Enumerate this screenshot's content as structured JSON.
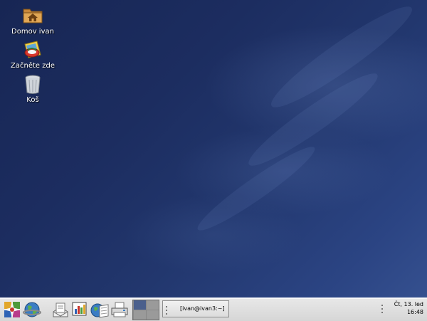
{
  "desktop": {
    "icons": [
      {
        "label": "Domov ivan",
        "icon": "home-folder-icon"
      },
      {
        "label": "Začněte zde",
        "icon": "start-here-icon"
      },
      {
        "label": "Koš",
        "icon": "trash-icon"
      }
    ]
  },
  "panel": {
    "launchers": [
      {
        "name": "main-menu-icon"
      },
      {
        "name": "web-browser-icon"
      },
      {
        "name": "email-client-icon"
      },
      {
        "name": "presentation-icon"
      },
      {
        "name": "document-editor-icon"
      },
      {
        "name": "printer-icon"
      }
    ],
    "workspaces": {
      "count": 4,
      "active": 1
    },
    "taskbar": {
      "items": [
        {
          "label": "[ivan@ivan3:~]"
        }
      ]
    },
    "clock": {
      "day": "Čt, 13. led",
      "time": "16:48"
    }
  },
  "colors": {
    "desktop_bg": "#1c2d60",
    "panel_bg": "#dcdcdc",
    "active_workspace": "#4a5f8c"
  }
}
